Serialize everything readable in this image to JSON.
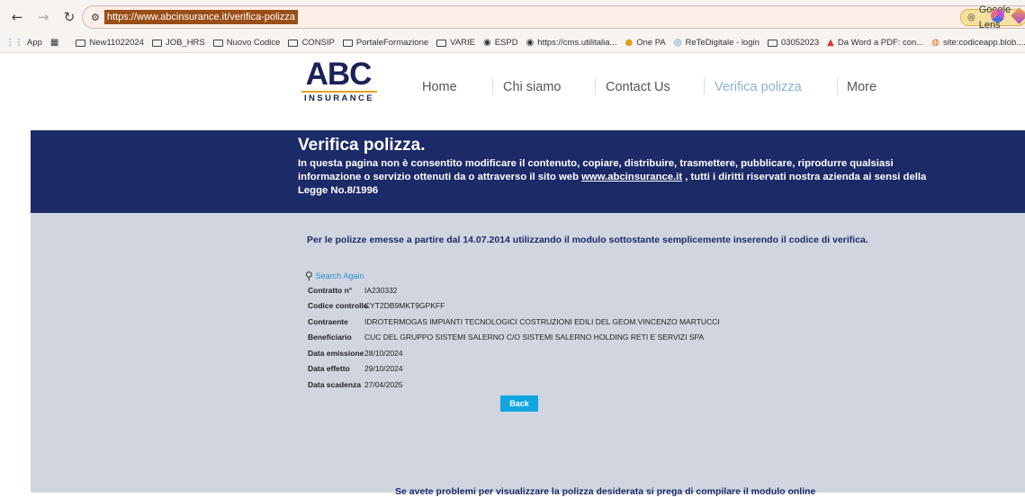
{
  "browser": {
    "url": "https://www.abcinsurance.it/verifica-polizza",
    "lens_label": "Google Lens",
    "bookmarks": [
      {
        "label": "App",
        "icon": "apps-grid-icon"
      },
      {
        "label": "",
        "icon": "tab-groups-icon"
      },
      {
        "label": "New11022024",
        "icon": "folder-icon"
      },
      {
        "label": "JOB_HRS",
        "icon": "folder-icon"
      },
      {
        "label": "Nuovo Codice",
        "icon": "folder-icon"
      },
      {
        "label": "CONSIP",
        "icon": "folder-icon"
      },
      {
        "label": "PortaleFormazione",
        "icon": "folder-icon"
      },
      {
        "label": "VARIE",
        "icon": "folder-icon"
      },
      {
        "label": "ESPD",
        "icon": "globe-icon"
      },
      {
        "label": "https://cms.utilitalia...",
        "icon": "globe-icon"
      },
      {
        "label": "One PA",
        "icon": "onepa-icon"
      },
      {
        "label": "ReTeDigitale - login",
        "icon": "retedigitale-icon"
      },
      {
        "label": "03052023",
        "icon": "folder-icon"
      },
      {
        "label": "Da Word a PDF: con...",
        "icon": "pdf-icon"
      },
      {
        "label": "site:codiceapp.blob....",
        "icon": "site-icon"
      }
    ]
  },
  "site": {
    "logo_main": "ABC",
    "logo_sub": "INSURANCE",
    "menu": [
      "Home",
      "Chi siamo",
      "Contact Us",
      "Verifica polizza",
      "More"
    ]
  },
  "hero": {
    "title": "Verifica polizza.",
    "text_before_link": "In questa pagina non è consentito modificare il contenuto, copiare, distribuire, trasmettere, pubblicare, riprodurre qualsiasi informazione o servizio ottenuti da o attraverso il sito web ",
    "link": "www.abcinsurance.it",
    "text_after_link": " , tutti i diritti riservati nostra azienda ai sensi della Legge No.8/1996"
  },
  "content": {
    "intro": "Per le polizze emesse a partire dal 14.07.2014 utilizzando il modulo sottostante semplicemente inserendo il codice di verifica.",
    "search_again": "Search Again",
    "details": [
      {
        "label": "Contratto n°",
        "value": "IA230332"
      },
      {
        "label": "Codice controllo",
        "value": "CYT2DB9MKT9GPKFF"
      },
      {
        "label": "Contraente",
        "value": "IDROTERMOGAS IMPIANTI TECNOLOGICI COSTRUZIONI EDILI DEL GEOM.VINCENZO MARTUCCI"
      },
      {
        "label": "Beneficiario",
        "value": "CUC DEL GRUPPO SISTEMI SALERNO C/O SISTEMI SALERNO HOLDING RETI E SERVIZI SPA"
      },
      {
        "label": "Data emissione",
        "value": "28/10/2024"
      },
      {
        "label": "Data effetto",
        "value": "29/10/2024"
      },
      {
        "label": "Data scadenza",
        "value": "27/04/2025"
      }
    ],
    "back_label": "Back",
    "footer_note": "Se avete problemi per visualizzare la polizza desiderata si prega di compilare il modulo online"
  },
  "colors": {
    "brand_navy": "#1d2a68",
    "accent_orange": "#e8a020",
    "button_blue": "#10a5e0",
    "link_blue": "#2e8fd0",
    "content_bg": "#d0d5e0"
  }
}
